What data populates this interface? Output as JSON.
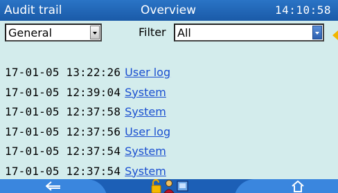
{
  "header": {
    "app_title": "Audit trail",
    "view_title": "Overview",
    "clock": "14:10:58"
  },
  "controls": {
    "category_select": {
      "selected": "General"
    },
    "filter_label": "Filter",
    "filter_select": {
      "selected": "All"
    }
  },
  "log_entries": [
    {
      "timestamp": "17-01-05 13:22:26",
      "type": "User log"
    },
    {
      "timestamp": "17-01-05 12:39:04",
      "type": "System"
    },
    {
      "timestamp": "17-01-05 12:37:58",
      "type": "System"
    },
    {
      "timestamp": "17-01-05 12:37:56",
      "type": "User log"
    },
    {
      "timestamp": "17-01-05 12:37:54",
      "type": "System"
    },
    {
      "timestamp": "17-01-05 12:37:54",
      "type": "System"
    }
  ],
  "footer": {
    "icons": [
      "back-arrow-icon",
      "unlock-icon",
      "user-icon",
      "monitor-icon",
      "home-icon"
    ]
  },
  "colors": {
    "title_bar": "#1a5aa8",
    "background": "#d3ecec",
    "link": "#1a4fd0",
    "footer_bar": "#1c5fb6",
    "footer_tab": "#3a86de",
    "scroll_marker": "#f2b600"
  }
}
